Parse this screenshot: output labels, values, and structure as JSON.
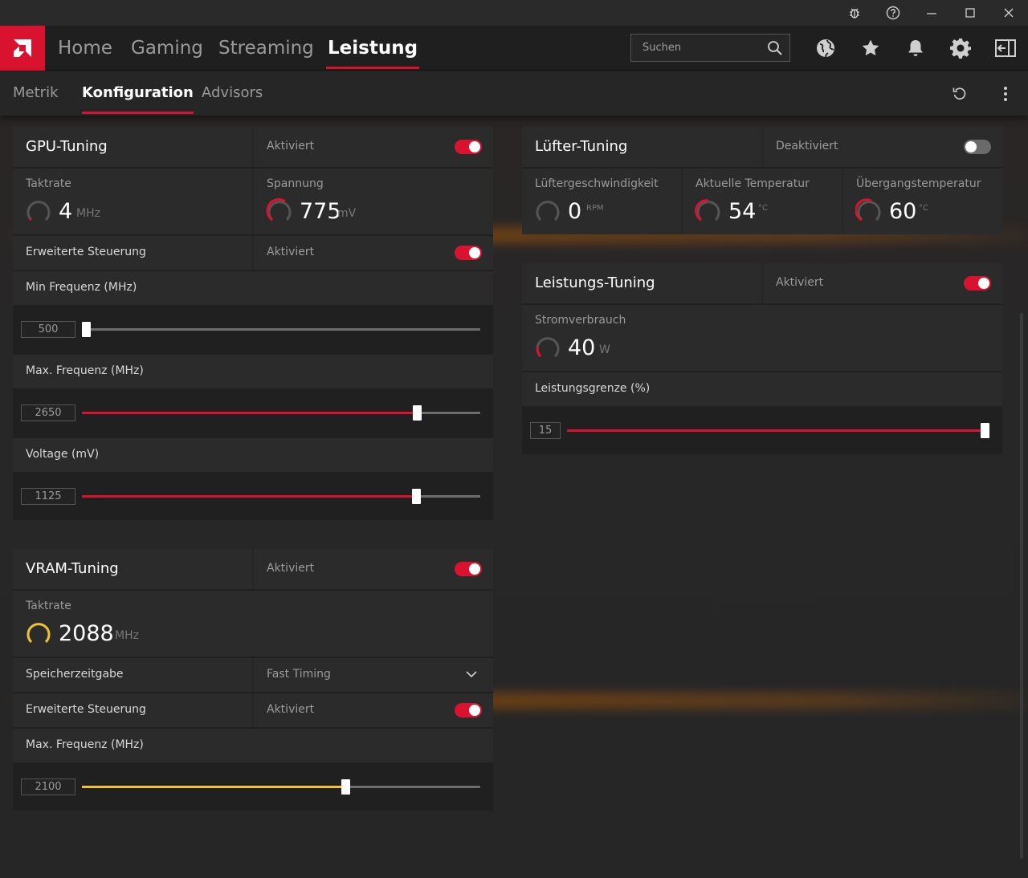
{
  "titlebar": {
    "icons": [
      "bug-icon",
      "help-icon",
      "minimize-icon",
      "maximize-icon",
      "close-icon"
    ]
  },
  "nav": {
    "tabs": [
      {
        "label": "Home"
      },
      {
        "label": "Gaming"
      },
      {
        "label": "Streaming"
      },
      {
        "label": "Leistung",
        "active": true
      }
    ],
    "search_placeholder": "Suchen",
    "icons": [
      "globe-icon",
      "star-icon",
      "bell-icon",
      "gear-icon",
      "sidebar-icon"
    ]
  },
  "subnav": {
    "tabs": [
      {
        "label": "Metrik"
      },
      {
        "label": "Konfiguration",
        "active": true
      },
      {
        "label": "Advisors"
      }
    ],
    "icons": [
      "reset-icon",
      "more-icon"
    ]
  },
  "colors": {
    "accent": "#d8122f",
    "vram": "#f1c234",
    "panel": "#2b2b2b"
  },
  "gpu": {
    "title": "GPU-Tuning",
    "status": "Aktiviert",
    "enabled": true,
    "clock": {
      "label": "Taktrate",
      "value": "4",
      "unit": "MHz"
    },
    "voltage": {
      "label": "Spannung",
      "value": "775",
      "unit": "mV"
    },
    "advanced": {
      "label": "Erweiterte Steuerung",
      "status": "Aktiviert",
      "enabled": true
    },
    "min_freq": {
      "label": "Min Frequenz (MHz)",
      "value": "500",
      "fraction": 0.0
    },
    "max_freq": {
      "label": "Max. Frequenz (MHz)",
      "value": "2650",
      "fraction": 0.85
    },
    "voltage_slider": {
      "label": "Voltage (mV)",
      "value": "1125",
      "fraction": 0.847
    }
  },
  "vram": {
    "title": "VRAM-Tuning",
    "status": "Aktiviert",
    "enabled": true,
    "clock": {
      "label": "Taktrate",
      "value": "2088",
      "unit": "MHz"
    },
    "timing": {
      "label": "Speicherzeitgabe",
      "value": "Fast Timing"
    },
    "advanced": {
      "label": "Erweiterte Steuerung",
      "status": "Aktiviert",
      "enabled": true
    },
    "max_freq": {
      "label": "Max. Frequenz (MHz)",
      "value": "2100",
      "fraction": 0.665
    }
  },
  "fan": {
    "title": "Lüfter-Tuning",
    "status": "Deaktiviert",
    "enabled": false,
    "speed": {
      "label": "Lüftergeschwindigkeit",
      "value": "0",
      "unit": "RPM"
    },
    "temp": {
      "label": "Aktuelle Temperatur",
      "value": "54",
      "unit": "°C"
    },
    "junction": {
      "label": "Übergangstemperatur",
      "value": "60",
      "unit": "°C"
    }
  },
  "power": {
    "title": "Leistungs-Tuning",
    "status": "Aktiviert",
    "enabled": true,
    "consumption": {
      "label": "Stromverbrauch",
      "value": "40",
      "unit": "W"
    },
    "limit": {
      "label": "Leistungsgrenze (%)",
      "value": "15",
      "fraction": 1.0
    }
  }
}
